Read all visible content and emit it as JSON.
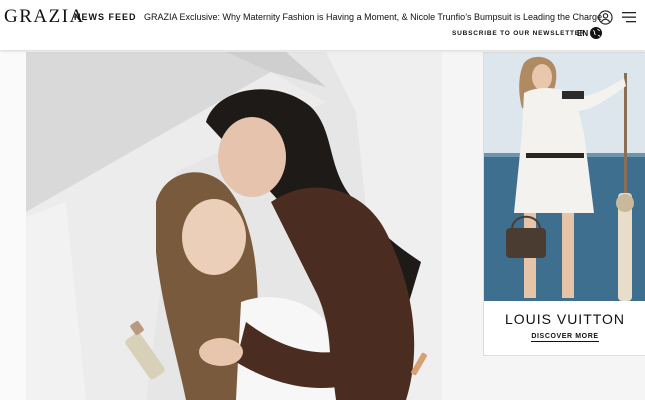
{
  "header": {
    "logo": "GRAZIA",
    "news_feed_label": "NEWS FEED",
    "ticker_text": "GRAZIA Exclusive: Why Maternity Fashion is Having a Moment, & Nicole Trunfio’s Bumpsuit is Leading the Charge",
    "subscribe_label": "SUBSCRIBE TO OUR NEWSLETTER",
    "language": "EN",
    "icons": [
      "user-icon",
      "menu-icon",
      "globe-icon"
    ]
  },
  "ad": {
    "brand": "LOUIS VUITTON",
    "cta": "DISCOVER MORE"
  },
  "colors": {
    "text": "#111111",
    "background": "#f5f5f5",
    "sea": "#3f6f8f",
    "dress": "#5b3a2a"
  }
}
